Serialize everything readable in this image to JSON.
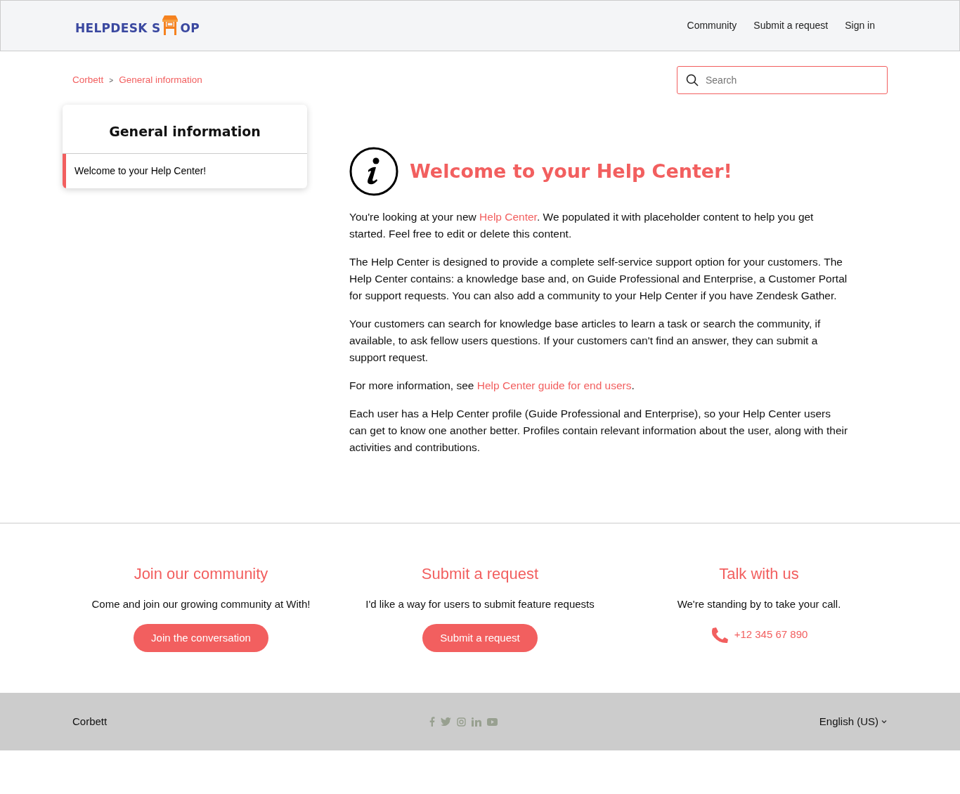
{
  "header": {
    "logo": {
      "left": "HELPDESK S",
      "right": "OP"
    },
    "nav": [
      "Community",
      "Submit a request",
      "Sign in"
    ]
  },
  "breadcrumbs": {
    "separator": ">",
    "items": [
      "Corbett",
      "General information"
    ]
  },
  "search": {
    "placeholder": "Search"
  },
  "sidebar": {
    "title": "General information",
    "items": [
      {
        "label": "Welcome to your Help Center!",
        "selected": true
      }
    ]
  },
  "article": {
    "title": "Welcome to your Help Center!",
    "paragraphs": [
      [
        {
          "text": "You're looking at your new "
        },
        {
          "text": "Help Center",
          "link": true
        },
        {
          "text": ". We populated it with placeholder content to help you get started. Feel free to edit or delete this content."
        }
      ],
      [
        {
          "text": "The Help Center is designed to provide a complete self-service support option for your customers. The Help Center contains: a knowledge base and, on Guide Professional and Enterprise, a Customer Portal for support requests. You can also add a community to your Help Center if you have Zendesk Gather."
        }
      ],
      [
        {
          "text": "Your customers can search for knowledge base articles to learn a task or search the community, if available, to ask fellow users questions. If your customers can't find an answer, they can submit a support request."
        }
      ],
      [
        {
          "text": "For more information, see "
        },
        {
          "text": "Help Center guide for end users",
          "link": true
        },
        {
          "text": "."
        }
      ],
      [
        {
          "text": "Each user has a Help Center profile (Guide Professional and Enterprise), so your Help Center users can get to know one another better. Profiles contain relevant information about the user, along with their activities and contributions."
        }
      ]
    ]
  },
  "promos": [
    {
      "kind": "button",
      "title": "Join our community",
      "text": "Come and join our growing community at With!",
      "action": "Join the conversation"
    },
    {
      "kind": "button",
      "title": "Submit a request",
      "text": "I'd like a way for users to submit feature requests",
      "action": "Submit a request"
    },
    {
      "kind": "phone",
      "title": "Talk with us",
      "text": "We're standing by to take your call.",
      "action": "+12 345 67 890"
    }
  ],
  "footer": {
    "brand": "Corbett",
    "language": "English (US)"
  }
}
